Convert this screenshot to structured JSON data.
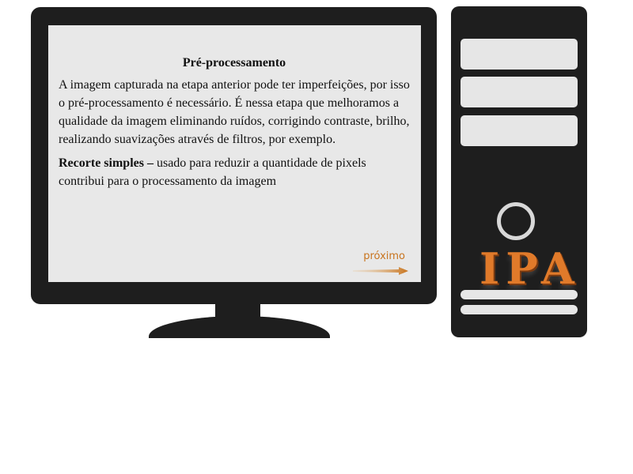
{
  "slide": {
    "title": "Pré-processamento",
    "paragraph1": "A imagem capturada na etapa anterior pode ter imperfeições, por isso o pré-processamento é necessário. É nessa etapa que melhoramos a qualidade da imagem eliminando ruídos, corrigindo contraste, brilho, realizando suavizações através de filtros, por exemplo.",
    "paragraph2_bold": "Recorte simples –",
    "paragraph2_rest": " usado para reduzir a quantidade de pixels contribui para o processamento da imagem",
    "next_label": "próximo"
  },
  "tower": {
    "logo_text": "IPA"
  },
  "colors": {
    "frame": "#1e1e1e",
    "screen": "#e8e8e8",
    "accent": "#c8741e",
    "logo": "#e07a2a"
  },
  "icons": {
    "next": "arrow-right-icon",
    "power": "power-button-icon"
  }
}
